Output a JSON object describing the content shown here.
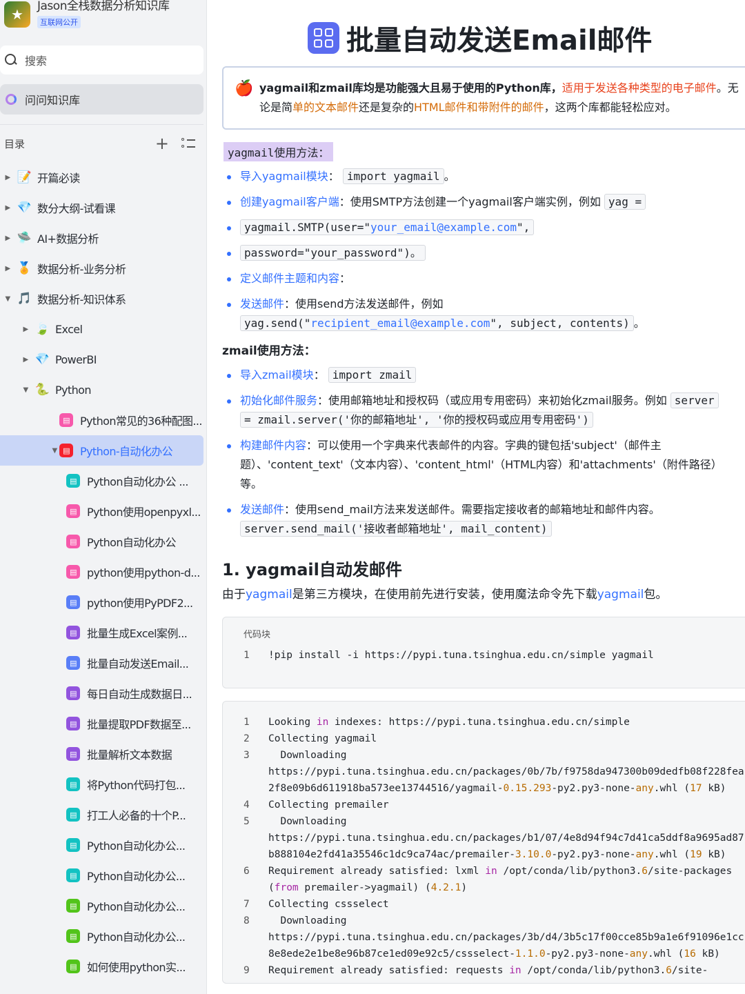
{
  "kb": {
    "title": "Jason全栈数据分析知识库",
    "badge": "互联网公开",
    "search": "搜索",
    "ask": "问问知识库",
    "toc_label": "目录"
  },
  "tree": [
    {
      "label": "开篇必读",
      "emoji": "📝",
      "level": 0
    },
    {
      "label": "数分大纲-试看课",
      "emoji": "💎",
      "level": 0
    },
    {
      "label": "AI+数据分析",
      "emoji": "🛸",
      "level": 0
    },
    {
      "label": "数据分析-业务分析",
      "emoji": "🏅",
      "level": 0
    },
    {
      "label": "数据分析-知识体系",
      "emoji": "🎵",
      "level": 0
    },
    {
      "label": "Excel",
      "emoji": "🍃",
      "level": 1
    },
    {
      "label": "PowerBI",
      "emoji": "💎",
      "level": 1
    },
    {
      "label": "Python",
      "emoji": "🐍",
      "level": 1
    },
    {
      "label": "Python常见的36种配图...",
      "color": "#f759ab",
      "level": 2
    },
    {
      "label": "Python-自动化办公",
      "color": "#f5222d",
      "level": 2
    },
    {
      "label": "Python自动化办公 ...",
      "color": "#13c2c2",
      "level": 3
    },
    {
      "label": "Python使用openpyxl...",
      "color": "#f759ab",
      "level": 3
    },
    {
      "label": "Python自动化办公",
      "color": "#f759ab",
      "level": 3
    },
    {
      "label": "python使用python-d...",
      "color": "#f759ab",
      "level": 3
    },
    {
      "label": "python使用PyPDF2...",
      "color": "#597ef7",
      "level": 3
    },
    {
      "label": "批量生成Excel案例...",
      "color": "#9254de",
      "level": 3
    },
    {
      "label": "批量自动发送Email...",
      "color": "#597ef7",
      "level": 3
    },
    {
      "label": "每日自动生成数据日...",
      "color": "#9254de",
      "level": 3
    },
    {
      "label": "批量提取PDF数据至...",
      "color": "#9254de",
      "level": 3
    },
    {
      "label": "批量解析文本数据",
      "color": "#9254de",
      "level": 3
    },
    {
      "label": "将Python代码打包...",
      "color": "#13c2c2",
      "level": 3
    },
    {
      "label": "打工人必备的十个P...",
      "color": "#13c2c2",
      "level": 3
    },
    {
      "label": "Python自动化办公...",
      "color": "#13c2c2",
      "level": 3
    },
    {
      "label": "Python自动化办公...",
      "color": "#13c2c2",
      "level": 3
    },
    {
      "label": "Python自动化办公...",
      "color": "#52c41a",
      "level": 3
    },
    {
      "label": "Python自动化办公...",
      "color": "#52c41a",
      "level": 3
    },
    {
      "label": "如何使用python实...",
      "color": "#52c41a",
      "level": 3
    }
  ],
  "doc": {
    "title": "批量自动发送Email邮件",
    "callout": {
      "a": "yagmail和zmail库均是功能强大且易于使用的Python库，",
      "b": "适用于发送各种类型的电子邮件",
      "c": "。无论是简",
      "d": "单的文本邮件",
      "e": "还是复杂的",
      "f": "HTML邮件和带附件的邮件",
      "g": "，这两个库都能轻松应对。"
    },
    "yag_label": "yagmail使用方法：",
    "yag": {
      "import_lbl": "导入yagmail模块",
      "import_code": "import yagmail",
      "create_lbl": "创建yagmail客户端",
      "create_txt": "：使用SMTP方法创建一个yagmail客户端实例，例如",
      "create_code": "yag =",
      "smtp_pre": "yagmail.SMTP(user=\"",
      "smtp_email": "your_email@example.com",
      "smtp_post": "\",",
      "pw_code": " password=\"your_password\")。",
      "define_lbl": "定义邮件主题和内容",
      "send_lbl": "发送邮件",
      "send_txt": "：使用send方法发送邮件，例如",
      "send_pre": "yag.send(\"",
      "send_email": "recipient_email@example.com",
      "send_post": "\", subject, contents)",
      "period": "。"
    },
    "zmail_label": "zmail使用方法：",
    "zmail": {
      "import_lbl": "导入zmail模块",
      "import_code": "import zmail",
      "init_lbl": "初始化邮件服务",
      "init_txt": "：使用邮箱地址和授权码（或应用专用密码）来初始化zmail服务。例如",
      "init_code1": "server",
      "init_code2": "= zmail.server('你的邮箱地址', '你的授权码或应用专用密码')",
      "build_lbl": "构建邮件内容",
      "build_txt": "：可以使用一个字典来代表邮件的内容。字典的键包括'subject'（邮件主题）、'content_text'（文本内容）、'content_html'（HTML内容）和'attachments'（附件路径）等。",
      "send_lbl": "发送邮件",
      "send_txt": "：使用send_mail方法来发送邮件。需要指定接收者的邮箱地址和邮件内容。",
      "send_code": "server.send_mail('接收者邮箱地址', mail_content)"
    },
    "h2": "1. yagmail自动发邮件",
    "para_a": "由于",
    "para_b": "yagmail",
    "para_c": "是第三方模块，在使用前先进行安装，使用魔法命令先下载",
    "para_d": "yagmail",
    "para_e": "包。",
    "code1_head": "代码块",
    "code1_line": "!pip install -i https://pypi.tuna.tsinghua.edu.cn/simple yagmail"
  }
}
